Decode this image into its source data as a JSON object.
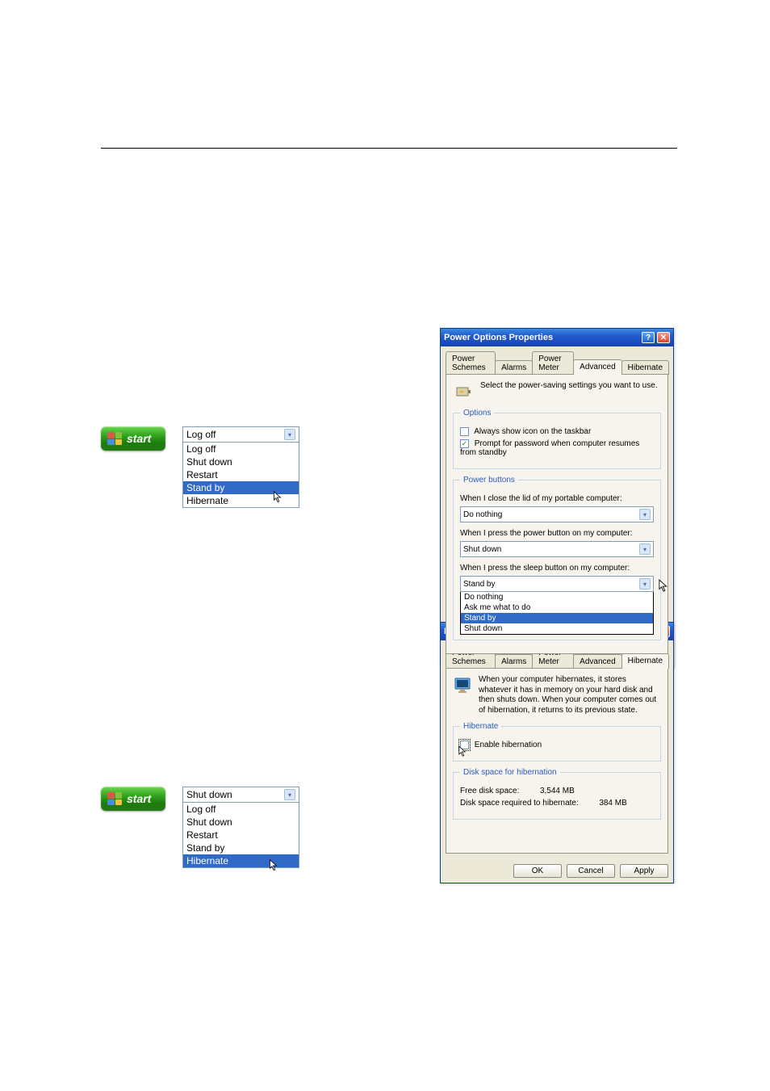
{
  "start_label": "start",
  "dropdown1": {
    "selected": "Log off",
    "options": [
      "Log off",
      "Shut down",
      "Restart",
      "Stand by",
      "Hibernate"
    ],
    "highlighted": "Stand by"
  },
  "dropdown2": {
    "selected": "Shut down",
    "options": [
      "Log off",
      "Shut down",
      "Restart",
      "Stand by",
      "Hibernate"
    ],
    "highlighted": "Hibernate"
  },
  "dialog": {
    "title": "Power Options Properties",
    "tabs": [
      "Power Schemes",
      "Alarms",
      "Power Meter",
      "Advanced",
      "Hibernate"
    ]
  },
  "advanced_tab": {
    "intro": "Select the power-saving settings you want to use.",
    "options_legend": "Options",
    "opt_show_icon": "Always show icon on the taskbar",
    "opt_prompt_pw": "Prompt for password when computer resumes from standby",
    "pb_legend": "Power buttons",
    "q_close_lid": "When I close the lid of my portable computer:",
    "a_close_lid": "Do nothing",
    "q_power_btn": "When I press the power button on my computer:",
    "a_power_btn": "Shut down",
    "q_sleep_btn": "When I press the sleep button on my computer:",
    "a_sleep_btn": "Stand by",
    "sleep_opts": [
      "Do nothing",
      "Ask me what to do",
      "Stand by",
      "Shut down"
    ],
    "sleep_hl": "Stand by"
  },
  "hibernate_tab": {
    "intro": "When your computer hibernates, it stores whatever it has in memory on your hard disk and then shuts down. When your computer comes out of hibernation, it returns to its previous state.",
    "legend_hib": "Hibernate",
    "enable_label": "Enable hibernation",
    "legend_disk": "Disk space for hibernation",
    "free_label": "Free disk space:",
    "free_value": "3,544 MB",
    "req_label": "Disk space required to hibernate:",
    "req_value": "384 MB"
  },
  "buttons": {
    "ok": "OK",
    "cancel": "Cancel",
    "apply": "Apply"
  }
}
